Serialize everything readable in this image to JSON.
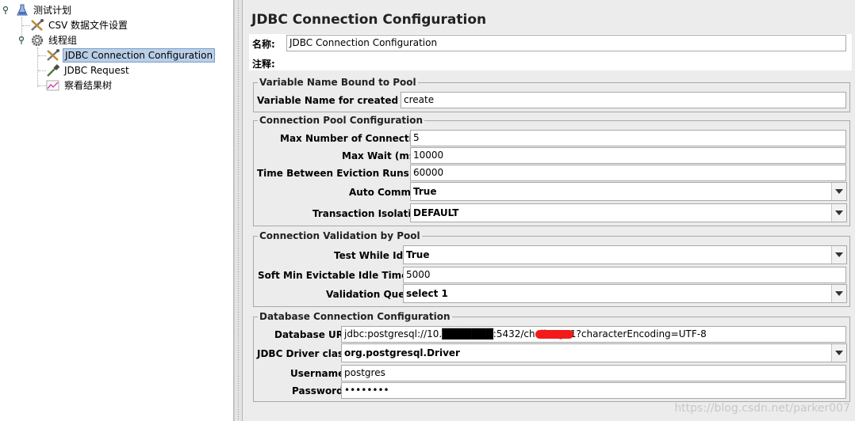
{
  "tree": {
    "test_plan": "测试计划",
    "csv_config": "CSV 数据文件设置",
    "thread_group": "线程组",
    "jdbc_connection": "JDBC Connection Configuration",
    "jdbc_request": "JDBC Request",
    "result_tree": "察看结果树"
  },
  "panel": {
    "title": "JDBC Connection Configuration",
    "name_label": "名称:",
    "name_value": "JDBC Connection Configuration",
    "comment_label": "注释:",
    "groups": {
      "var_bound": {
        "legend": "Variable Name Bound to Pool",
        "var_name_label": "Variable Name for created pool:",
        "var_name_value": "create"
      },
      "pool": {
        "legend": "Connection Pool Configuration",
        "max_conn_label": "Max Number of Connections:",
        "max_conn_value": "5",
        "max_wait_label": "Max Wait (ms):",
        "max_wait_value": "10000",
        "eviction_label": "Time Between Eviction Runs (ms):",
        "eviction_value": "60000",
        "auto_commit_label": "Auto Commit:",
        "auto_commit_value": "True",
        "isolation_label": "Transaction Isolation:",
        "isolation_value": "DEFAULT"
      },
      "validation": {
        "legend": "Connection Validation by Pool",
        "test_idle_label": "Test While Idle:",
        "test_idle_value": "True",
        "soft_min_label": "Soft Min Evictable Idle Time(ms):",
        "soft_min_value": "5000",
        "query_label": "Validation Query:",
        "query_value": "select 1"
      },
      "database": {
        "legend": "Database Connection Configuration",
        "url_label": "Database URL:",
        "url_value": "jdbc:postgresql://10.███████:5432/cheliang01?characterEncoding=UTF-8",
        "driver_label": "JDBC Driver class:",
        "driver_value": "org.postgresql.Driver",
        "username_label": "Username:",
        "username_value": "postgres",
        "password_label": "Password:",
        "password_value": "••••••••"
      }
    }
  },
  "watermark": "https://blog.csdn.net/parker007"
}
